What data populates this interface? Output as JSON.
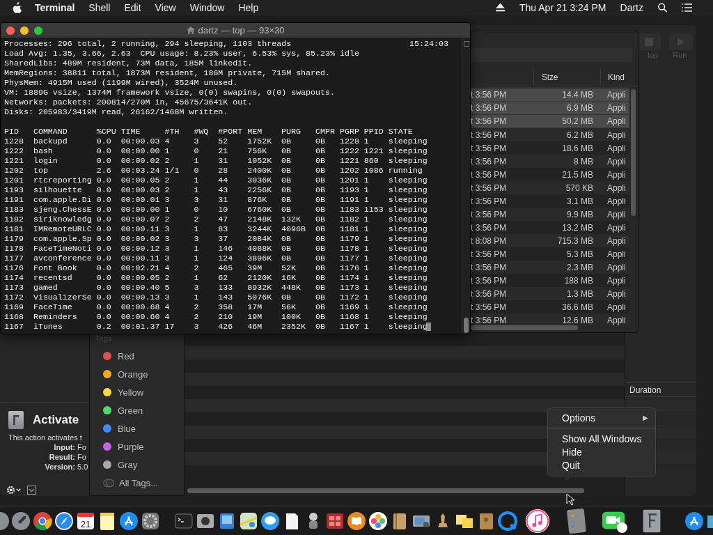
{
  "menu_bar": {
    "app": "Terminal",
    "menus": [
      "Shell",
      "Edit",
      "View",
      "Window",
      "Help"
    ],
    "clock": "Thu Apr 21  3:24 PM",
    "user": "Dartz"
  },
  "automator": {
    "toolbar": [
      "top",
      "Run"
    ],
    "action": {
      "title": "Activate",
      "description": "This action activates t",
      "fields": [
        {
          "label": "Input:",
          "value": "Fo"
        },
        {
          "label": "Result:",
          "value": "Fo"
        },
        {
          "label": "Version:",
          "value": "5.0"
        }
      ]
    },
    "duration_header": "Duration"
  },
  "finder": {
    "columns": [
      "Size",
      "Kind"
    ],
    "rows": [
      {
        "date": "t 3:56 PM",
        "size": "14.4 MB",
        "kind": "Appli",
        "selected": true
      },
      {
        "date": "t 3:56 PM",
        "size": "6.9 MB",
        "kind": "Appli",
        "selected": true
      },
      {
        "date": "t 3:56 PM",
        "size": "50.2 MB",
        "kind": "Appli",
        "selected": true
      },
      {
        "date": "t 3:56 PM",
        "size": "6.2 MB",
        "kind": "Appli",
        "selected": false
      },
      {
        "date": "t 3:56 PM",
        "size": "18.6 MB",
        "kind": "Appli",
        "selected": false
      },
      {
        "date": "t 3:56 PM",
        "size": "8 MB",
        "kind": "Appli",
        "selected": false
      },
      {
        "date": "t 3:56 PM",
        "size": "21.5 MB",
        "kind": "Appli",
        "selected": false
      },
      {
        "date": "t 3:56 PM",
        "size": "570 KB",
        "kind": "Appli",
        "selected": false
      },
      {
        "date": "t 3:56 PM",
        "size": "3.1 MB",
        "kind": "Appli",
        "selected": false
      },
      {
        "date": "t 3:56 PM",
        "size": "9.9 MB",
        "kind": "Appli",
        "selected": false
      },
      {
        "date": "t 3:56 PM",
        "size": "13.2 MB",
        "kind": "Appli",
        "selected": false
      },
      {
        "date": "t 8:08 PM",
        "size": "715.3 MB",
        "kind": "Appli",
        "selected": false
      },
      {
        "date": "t 3:56 PM",
        "size": "5.3 MB",
        "kind": "Appli",
        "selected": false
      },
      {
        "date": "t 3:56 PM",
        "size": "2.3 MB",
        "kind": "Appli",
        "selected": false
      },
      {
        "date": "t 3:56 PM",
        "size": "188 MB",
        "kind": "Appli",
        "selected": false
      },
      {
        "date": "t 3:56 PM",
        "size": "1.3 MB",
        "kind": "Appli",
        "selected": false
      },
      {
        "date": "t 3:56 PM",
        "size": "36.6 MB",
        "kind": "Appli",
        "selected": false
      },
      {
        "date": "t 3:56 PM",
        "size": "12.6 MB",
        "kind": "Appli",
        "selected": false
      }
    ]
  },
  "terminal": {
    "title": "dartz — top — 93×30",
    "time": "15:24:03",
    "summary": [
      "Processes: 296 total, 2 running, 294 sleeping, 1103 threads",
      "Load Avg: 1.35, 3.66, 2.63  CPU usage: 8.23% user, 6.53% sys, 85.23% idle",
      "SharedLibs: 489M resident, 73M data, 185M linkedit.",
      "MemRegions: 38811 total, 1873M resident, 186M private, 715M shared.",
      "PhysMem: 4915M used (1199M wired), 3524M unused.",
      "VM: 1889G vsize, 1374M framework vsize, 0(0) swapins, 0(0) swapouts.",
      "Networks: packets: 200814/270M in, 45675/3641K out.",
      "Disks: 205983/3419M read, 26162/1468M written."
    ],
    "columns": [
      "PID",
      "COMMAND",
      "%CPU",
      "TIME",
      "#TH",
      "#WQ",
      "#PORT",
      "MEM",
      "PURG",
      "CMPR",
      "PGRP",
      "PPID",
      "STATE"
    ],
    "processes": [
      [
        "1228",
        "backupd",
        "0.0",
        "00:00.03",
        "4",
        "3",
        "52",
        "1752K",
        "0B",
        "0B",
        "1228",
        "1",
        "sleeping"
      ],
      [
        "1222",
        "bash",
        "0.0",
        "00:00.00",
        "1",
        "0",
        "21",
        "756K",
        "0B",
        "0B",
        "1222",
        "1221",
        "sleeping"
      ],
      [
        "1221",
        "login",
        "0.0",
        "00:00.02",
        "2",
        "1",
        "31",
        "1052K",
        "0B",
        "0B",
        "1221",
        "860",
        "sleeping"
      ],
      [
        "1202",
        "top",
        "2.6",
        "00:03.24",
        "1/1",
        "0",
        "28",
        "2400K",
        "0B",
        "0B",
        "1202",
        "1086",
        "running"
      ],
      [
        "1201",
        "rtcreporting",
        "0.0",
        "00:00.05",
        "2",
        "1",
        "44",
        "3036K",
        "0B",
        "0B",
        "1201",
        "1",
        "sleeping"
      ],
      [
        "1193",
        "silhouette",
        "0.0",
        "00:00.03",
        "2",
        "1",
        "43",
        "2256K",
        "0B",
        "0B",
        "1193",
        "1",
        "sleeping"
      ],
      [
        "1191",
        "com.apple.Di",
        "0.0",
        "00:00.01",
        "3",
        "3",
        "31",
        "876K",
        "0B",
        "0B",
        "1191",
        "1",
        "sleeping"
      ],
      [
        "1183",
        "sjeng.ChessE",
        "0.0",
        "00:00.00",
        "1",
        "0",
        "10",
        "6760K",
        "0B",
        "0B",
        "1183",
        "1153",
        "sleeping"
      ],
      [
        "1182",
        "siriknowledg",
        "0.0",
        "00:00.07",
        "2",
        "2",
        "47",
        "2148K",
        "132K",
        "0B",
        "1182",
        "1",
        "sleeping"
      ],
      [
        "1181",
        "IMRemoteURLC",
        "0.0",
        "00:00.11",
        "3",
        "1",
        "83",
        "3244K",
        "4096B",
        "0B",
        "1181",
        "1",
        "sleeping"
      ],
      [
        "1179",
        "com.apple.Sp",
        "0.0",
        "00:00.02",
        "3",
        "3",
        "37",
        "2084K",
        "0B",
        "0B",
        "1179",
        "1",
        "sleeping"
      ],
      [
        "1178",
        "FaceTimeNoti",
        "0.0",
        "00:00.12",
        "3",
        "1",
        "146",
        "4088K",
        "0B",
        "0B",
        "1178",
        "1",
        "sleeping"
      ],
      [
        "1177",
        "avconference",
        "0.0",
        "00:00.11",
        "3",
        "1",
        "124",
        "3896K",
        "0B",
        "0B",
        "1177",
        "1",
        "sleeping"
      ],
      [
        "1176",
        "Font Book",
        "0.0",
        "00:02.21",
        "4",
        "2",
        "465",
        "39M",
        "52K",
        "0B",
        "1176",
        "1",
        "sleeping"
      ],
      [
        "1174",
        "recentsd",
        "0.0",
        "00:00.05",
        "2",
        "1",
        "62",
        "2120K",
        "16K",
        "0B",
        "1174",
        "1",
        "sleeping"
      ],
      [
        "1173",
        "gamed",
        "0.0",
        "00:00.40",
        "5",
        "3",
        "133",
        "8932K",
        "448K",
        "0B",
        "1173",
        "1",
        "sleeping"
      ],
      [
        "1172",
        "VisualizerSe",
        "0.0",
        "00:00.13",
        "3",
        "1",
        "143",
        "5076K",
        "0B",
        "0B",
        "1172",
        "1",
        "sleeping"
      ],
      [
        "1169",
        "FaceTime",
        "0.0",
        "00:00.68",
        "4",
        "2",
        "358",
        "17M",
        "56K",
        "0B",
        "1169",
        "1",
        "sleeping"
      ],
      [
        "1168",
        "Reminders",
        "0.0",
        "00:00.60",
        "4",
        "2",
        "210",
        "19M",
        "100K",
        "0B",
        "1168",
        "1",
        "sleeping"
      ],
      [
        "1167",
        "iTunes",
        "0.2",
        "00:01.37",
        "17",
        "3",
        "426",
        "46M",
        "2352K",
        "0B",
        "1167",
        "1",
        "sleeping"
      ]
    ]
  },
  "tags": {
    "title": "Tags",
    "items": [
      {
        "label": "Red",
        "color": "#e0524f"
      },
      {
        "label": "Orange",
        "color": "#f5a623"
      },
      {
        "label": "Yellow",
        "color": "#f7d93b"
      },
      {
        "label": "Green",
        "color": "#4cd964"
      },
      {
        "label": "Blue",
        "color": "#3f8cff"
      },
      {
        "label": "Purple",
        "color": "#c462e9"
      },
      {
        "label": "Gray",
        "color": "#a8a8a8"
      },
      {
        "label": "All Tags..."
      }
    ]
  },
  "context_menu": {
    "sections": [
      [
        {
          "label": "Options",
          "arrow": "▶"
        }
      ],
      [
        {
          "label": "Show All Windows"
        },
        {
          "label": "Hide"
        },
        {
          "label": "Quit"
        }
      ]
    ]
  },
  "dock": {
    "calendar_day": "21"
  }
}
